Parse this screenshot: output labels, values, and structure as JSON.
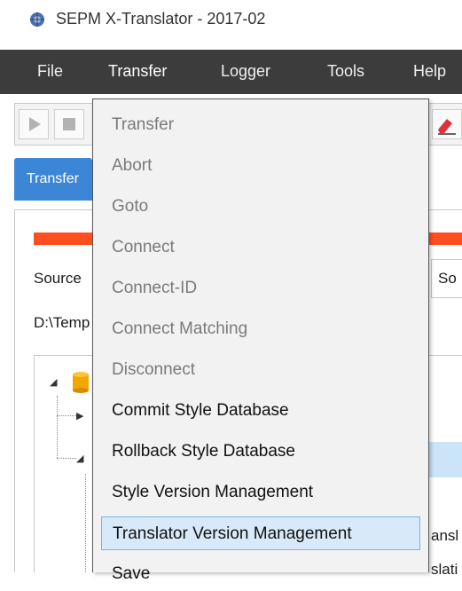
{
  "window": {
    "title": "SEPM X-Translator - 2017-02",
    "icon": "globe-gear-icon"
  },
  "menubar": {
    "items": [
      "File",
      "Transfer",
      "Logger",
      "Tools",
      "Help"
    ]
  },
  "toolbar": {
    "buttons": [
      "play-icon",
      "stop-icon",
      "eraser-icon"
    ]
  },
  "tabs": {
    "active": "Transfer"
  },
  "main": {
    "source_label": "Source",
    "source_label_right": "So",
    "path": "D:\\Temp",
    "tree_fragment_1": "ansl",
    "tree_fragment_2": "slati"
  },
  "transfer_menu": {
    "items": [
      {
        "label": "Transfer",
        "enabled": false
      },
      {
        "label": "Abort",
        "enabled": false
      },
      {
        "label": "Goto",
        "enabled": false
      },
      {
        "label": "Connect",
        "enabled": false
      },
      {
        "label": "Connect-ID",
        "enabled": false
      },
      {
        "label": "Connect Matching",
        "enabled": false
      },
      {
        "label": "Disconnect",
        "enabled": false
      },
      {
        "label": "Commit Style Database",
        "enabled": true
      },
      {
        "label": "Rollback Style Database",
        "enabled": true
      },
      {
        "label": "Style Version Management",
        "enabled": true
      },
      {
        "label": "Translator Version Management",
        "enabled": true,
        "hovered": true
      },
      {
        "label": "Save",
        "enabled": true
      }
    ]
  },
  "colors": {
    "menubar_bg": "#3c3c3c",
    "tab_active_bg": "#3c86d8",
    "progress": "#ff4e1f",
    "hover_bg": "#d8eaf9"
  }
}
